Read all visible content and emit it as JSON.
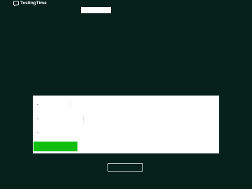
{
  "brand": {
    "name": "TestingTime",
    "icon": "speech-bubble-icon"
  },
  "colors": {
    "background": "#052119",
    "card": "#ffffff",
    "accent_green": "#0fbe0f",
    "button_outline": "#b8c2be"
  },
  "form": {
    "rows": [
      {
        "value": ""
      },
      {
        "value": ""
      },
      {
        "value": ""
      }
    ],
    "primary_button_label": ""
  },
  "secondary_button_label": ""
}
